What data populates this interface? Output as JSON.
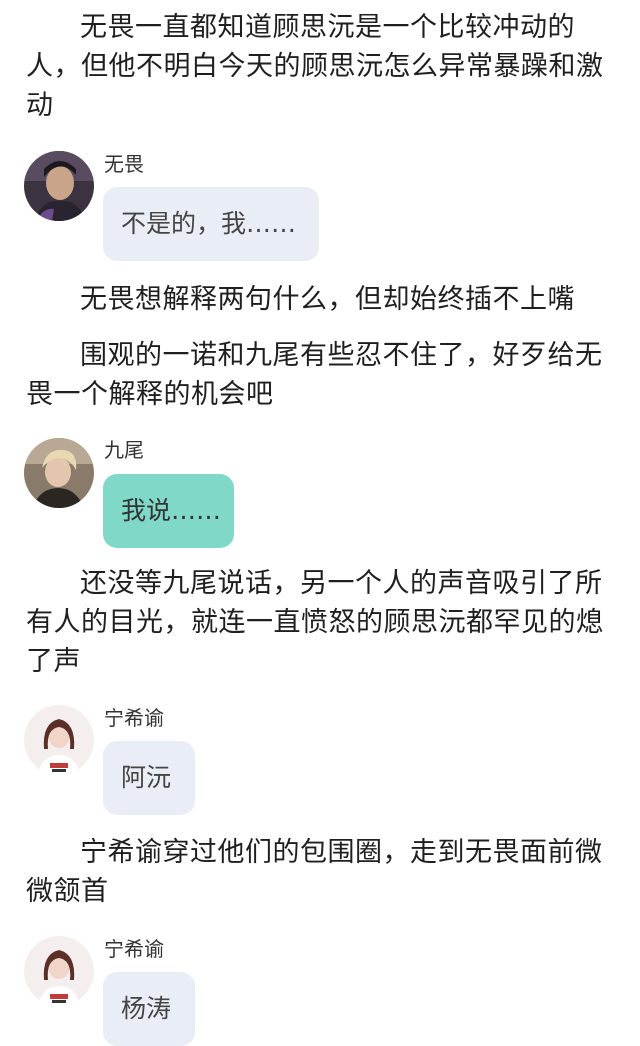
{
  "blocks": {
    "narration_1": "无畏一直都知道顾思沅是一个比较冲动的人，但他不明白今天的顾思沅怎么异常暴躁和激动",
    "message_1": {
      "speaker": "无畏",
      "text": "不是的，我……"
    },
    "narration_2": "无畏想解释两句什么，但却始终插不上嘴",
    "narration_3": "围观的一诺和九尾有些忍不住了，好歹给无畏一个解释的机会吧",
    "message_2": {
      "speaker": "九尾",
      "text": "我说……"
    },
    "narration_4": "还没等九尾说话，另一个人的声音吸引了所有人的目光，就连一直愤怒的顾思沅都罕见的熄了声",
    "message_3": {
      "speaker": "宁希谕",
      "text": "阿沅"
    },
    "narration_5": "宁希谕穿过他们的包围圈，走到无畏面前微微颔首",
    "message_4": {
      "speaker": "宁希谕",
      "text": "杨涛"
    }
  },
  "colors": {
    "grey_bubble": "#e9eef6",
    "teal_bubble": "#7fd8c8"
  },
  "icons": {
    "avatar_1": "avatar-wuwei-icon",
    "avatar_2": "avatar-jiuwei-icon",
    "avatar_3": "avatar-ningxiyu-icon"
  }
}
